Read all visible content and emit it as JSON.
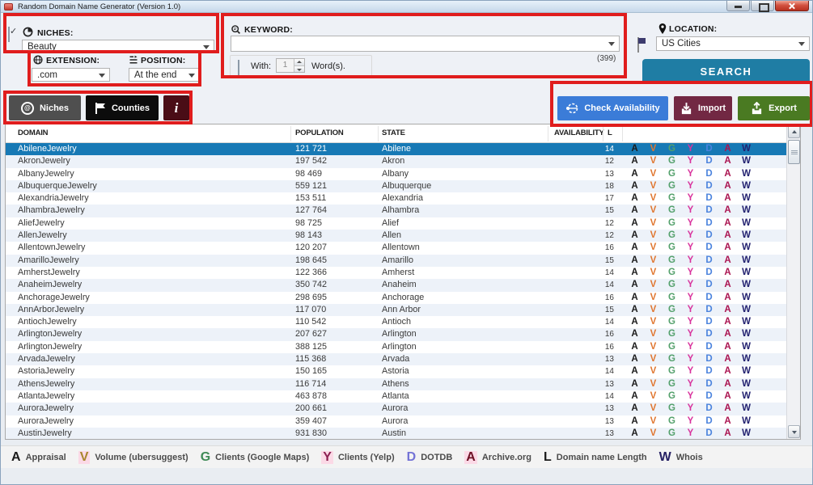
{
  "window": {
    "title": "Random Domain Name Generator (Version 1.0)"
  },
  "form": {
    "niches": {
      "label": "NICHES:",
      "value": "Beauty",
      "checked": true
    },
    "extension": {
      "label": "EXTENSION:",
      "value": ".com"
    },
    "position": {
      "label": "POSITION:",
      "value": "At the end"
    },
    "keyword": {
      "label": "KEYWORD:",
      "value": "",
      "count": "(399)",
      "with_label": "With:",
      "with_checked": false,
      "with_value": "1",
      "words_label": "Word(s)."
    },
    "location": {
      "label": "LOCATION:",
      "value": "US Cities"
    },
    "search_label": "SEARCH"
  },
  "toolbar": {
    "niches_label": "Niches",
    "counties_label": "Counties",
    "info_label": "i",
    "check_availability_label": "Check Availability",
    "import_label": "Import",
    "export_label": "Export"
  },
  "table": {
    "headers": [
      "DOMAIN",
      "POPULATION",
      "STATE",
      "AVAILABILITY",
      "L"
    ],
    "selected_index": 0,
    "letter_columns": [
      {
        "letter": "A",
        "color": "#1a1a1a",
        "name": "appraisal"
      },
      {
        "letter": "V",
        "color": "#e0762f",
        "name": "volume-ubersuggest"
      },
      {
        "letter": "G",
        "color": "#53a06b",
        "name": "clients-google-maps"
      },
      {
        "letter": "Y",
        "color": "#d8329c",
        "name": "clients-yelp"
      },
      {
        "letter": "D",
        "color": "#4b83dd",
        "name": "dotdb"
      },
      {
        "letter": "A",
        "color": "#aa1350",
        "name": "archive-org"
      },
      {
        "letter": "W",
        "color": "#232270",
        "name": "whois"
      }
    ],
    "rows": [
      {
        "domain": "AbileneJewelry",
        "population": "121 721",
        "state": "Abilene",
        "length": "14"
      },
      {
        "domain": "AkronJewelry",
        "population": "197 542",
        "state": "Akron",
        "length": "12"
      },
      {
        "domain": "AlbanyJewelry",
        "population": "98 469",
        "state": "Albany",
        "length": "13"
      },
      {
        "domain": "AlbuquerqueJewelry",
        "population": "559 121",
        "state": "Albuquerque",
        "length": "18"
      },
      {
        "domain": "AlexandriaJewelry",
        "population": "153 511",
        "state": "Alexandria",
        "length": "17"
      },
      {
        "domain": "AlhambraJewelry",
        "population": "127 764",
        "state": "Alhambra",
        "length": "15"
      },
      {
        "domain": "AliefJewelry",
        "population": "98 725",
        "state": "Alief",
        "length": "12"
      },
      {
        "domain": "AllenJewelry",
        "population": "98 143",
        "state": "Allen",
        "length": "12"
      },
      {
        "domain": "AllentownJewelry",
        "population": "120 207",
        "state": "Allentown",
        "length": "16"
      },
      {
        "domain": "AmarilloJewelry",
        "population": "198 645",
        "state": "Amarillo",
        "length": "15"
      },
      {
        "domain": "AmherstJewelry",
        "population": "122 366",
        "state": "Amherst",
        "length": "14"
      },
      {
        "domain": "AnaheimJewelry",
        "population": "350 742",
        "state": "Anaheim",
        "length": "14"
      },
      {
        "domain": "AnchorageJewelry",
        "population": "298 695",
        "state": "Anchorage",
        "length": "16"
      },
      {
        "domain": "AnnArborJewelry",
        "population": "117 070",
        "state": "Ann Arbor",
        "length": "15"
      },
      {
        "domain": "AntiochJewelry",
        "population": "110 542",
        "state": "Antioch",
        "length": "14"
      },
      {
        "domain": "ArlingtonJewelry",
        "population": "207 627",
        "state": "Arlington",
        "length": "16"
      },
      {
        "domain": "ArlingtonJewelry",
        "population": "388 125",
        "state": "Arlington",
        "length": "16"
      },
      {
        "domain": "ArvadaJewelry",
        "population": "115 368",
        "state": "Arvada",
        "length": "13"
      },
      {
        "domain": "AstoriaJewelry",
        "population": "150 165",
        "state": "Astoria",
        "length": "14"
      },
      {
        "domain": "AthensJewelry",
        "population": "116 714",
        "state": "Athens",
        "length": "13"
      },
      {
        "domain": "AtlantaJewelry",
        "population": "463 878",
        "state": "Atlanta",
        "length": "14"
      },
      {
        "domain": "AuroraJewelry",
        "population": "200 661",
        "state": "Aurora",
        "length": "13"
      },
      {
        "domain": "AuroraJewelry",
        "population": "359 407",
        "state": "Aurora",
        "length": "13"
      },
      {
        "domain": "AustinJewelry",
        "population": "931 830",
        "state": "Austin",
        "length": "13"
      }
    ]
  },
  "legend": [
    {
      "letter": "A",
      "label": "Appraisal",
      "color": "#1a1a1a",
      "highlight": false
    },
    {
      "letter": "V",
      "label": "Volume (ubersuggest)",
      "color": "#a8862c",
      "highlight": true
    },
    {
      "letter": "G",
      "label": "Clients (Google Maps)",
      "color": "#3f8a56",
      "highlight": false
    },
    {
      "letter": "Y",
      "label": "Clients (Yelp)",
      "color": "#8c2152",
      "highlight": true
    },
    {
      "letter": "D",
      "label": "DOTDB",
      "color": "#7473d6",
      "highlight": false
    },
    {
      "letter": "A",
      "label": "Archive.org",
      "color": "#6e1024",
      "highlight": true
    },
    {
      "letter": "L",
      "label": "Domain name Length",
      "color": "#1a1a1a",
      "highlight": false
    },
    {
      "letter": "W",
      "label": "Whois",
      "color": "#262163",
      "highlight": false
    }
  ]
}
